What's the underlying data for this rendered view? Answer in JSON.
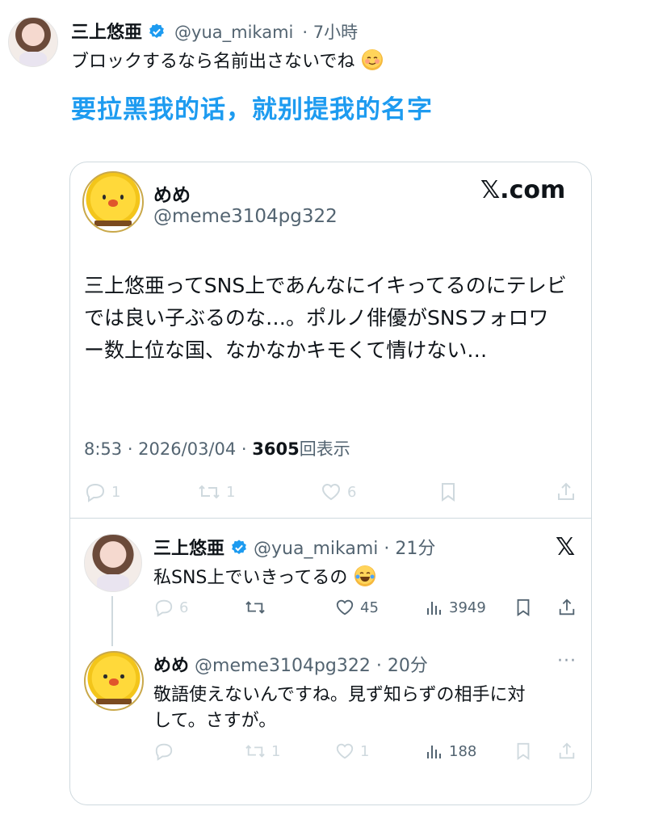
{
  "post": {
    "author_name": "三上悠亜",
    "author_handle": "@yua_mikami",
    "time": "· 7小時",
    "text": "ブロックするなら名前出さないでね",
    "translation": "要拉黑我的话，就别提我的名字"
  },
  "quoted": {
    "site": "𝕏.com",
    "author_name": "めめ",
    "author_handle": "@meme3104pg322",
    "body": "三上悠亜ってSNS上であんなにイキってるのにテレビでは良い子ぶるのな…。ポルノ俳優がSNSフォロワー数上位な国、なかなかキモくて情けない…",
    "timestamp": "8:53 · 2026/03/04 ·",
    "views": "3605",
    "views_label": "回表示",
    "actions": {
      "replies": "1",
      "reposts": "1",
      "likes": "6"
    }
  },
  "replies": [
    {
      "author_name": "三上悠亜",
      "author_handle": "@yua_mikami",
      "time": "· 21分",
      "text": "私SNS上でいきってるの",
      "actions": {
        "replies": "6",
        "reposts": "",
        "likes": "45",
        "views": "3949"
      }
    },
    {
      "author_name": "めめ",
      "author_handle": "@meme3104pg322",
      "time": "· 20分",
      "text_line1": "敬語使えないんですね。見ず知らずの相手に対",
      "text_line2": "して。さすが。",
      "more": "···",
      "actions": {
        "replies": "",
        "reposts": "1",
        "likes": "1",
        "views": "188"
      }
    }
  ],
  "icons": {
    "verified": "verified-badge-icon",
    "reply": "reply-icon",
    "repost": "repost-icon",
    "like": "heart-icon",
    "views": "views-icon",
    "bookmark": "bookmark-icon",
    "share": "share-icon"
  },
  "colors": {
    "accent": "#1d9bf0",
    "muted": "#536471",
    "border": "#cfd9de"
  }
}
